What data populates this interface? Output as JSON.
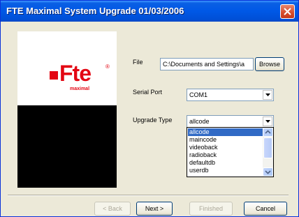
{
  "window": {
    "title": "FTE Maximal System Upgrade 01/03/2006"
  },
  "logo": {
    "text": "Fte",
    "registered": "®",
    "subtitle": "maximal"
  },
  "form": {
    "file_label": "File",
    "file_value": "C:\\Documents and Settings\\a",
    "browse_label": "Browse",
    "serial_port_label": "Serial Port",
    "serial_port_value": "COM1",
    "upgrade_type_label": "Upgrade Type",
    "upgrade_type_value": "allcode",
    "upgrade_type_options": [
      "allcode",
      "maincode",
      "videoback",
      "radioback",
      "defaultdb",
      "userdb"
    ]
  },
  "buttons": {
    "back": "< Back",
    "next": "Next >",
    "finished": "Finished",
    "cancel": "Cancel"
  },
  "icons": {
    "close": "close-icon",
    "dropdown": "chevron-down-icon",
    "scroll_up": "chevron-up-icon",
    "scroll_down": "chevron-down-icon"
  },
  "colors": {
    "titlebar": "#0058e6",
    "brand_red": "#e30613",
    "selection": "#316ac5"
  }
}
